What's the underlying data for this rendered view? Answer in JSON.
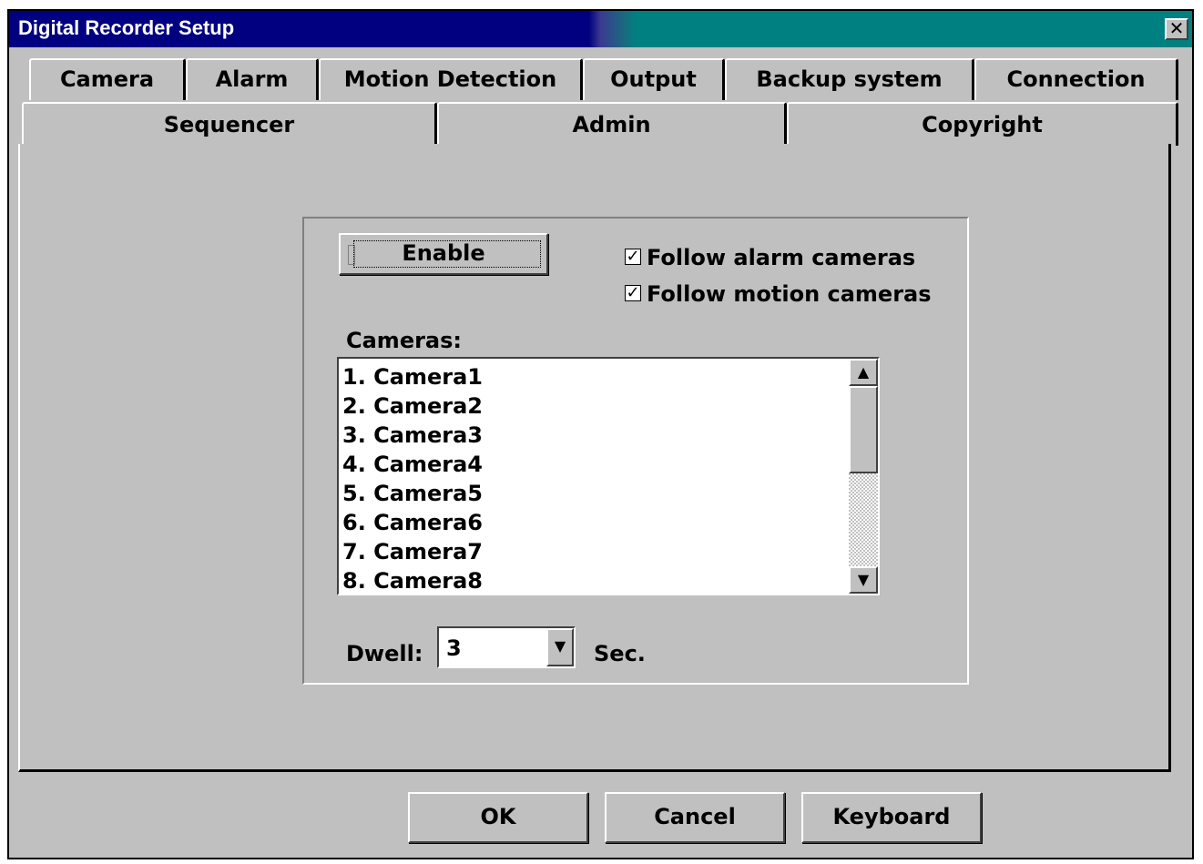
{
  "window": {
    "title": "Digital Recorder Setup",
    "close_label": "✕"
  },
  "tabs": {
    "back_row": [
      "Camera",
      "Alarm",
      "Motion Detection",
      "Output",
      "Backup system",
      "Connection"
    ],
    "front_row": [
      "Sequencer",
      "Admin",
      "Copyright"
    ],
    "active": "Sequencer"
  },
  "sequencer": {
    "enable_label": "Enable",
    "follow_alarm_label": "Follow alarm cameras",
    "follow_alarm_checked": true,
    "follow_motion_label": "Follow motion cameras",
    "follow_motion_checked": true,
    "cameras_label": "Cameras:",
    "cameras": [
      "1. Camera1",
      "2. Camera2",
      "3. Camera3",
      "4. Camera4",
      "5. Camera5",
      "6. Camera6",
      "7. Camera7",
      "8. Camera8"
    ],
    "dwell_label": "Dwell:",
    "dwell_value": "3",
    "dwell_unit": "Sec."
  },
  "buttons": {
    "ok": "OK",
    "cancel": "Cancel",
    "keyboard": "Keyboard"
  },
  "icons": {
    "check": "✓",
    "scroll_up": "▲",
    "scroll_down": "▼",
    "dropdown": "▼"
  }
}
